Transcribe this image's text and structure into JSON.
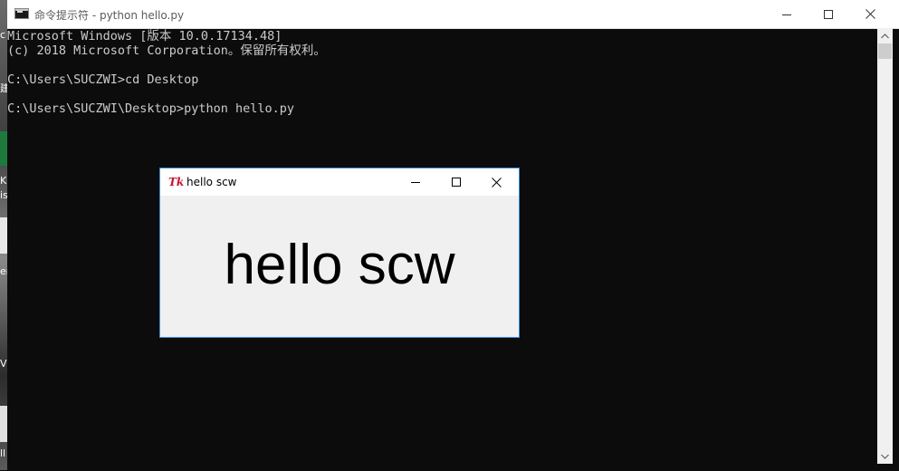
{
  "desktop": {
    "fragments": [
      "c",
      "建",
      "K",
      "is",
      "er",
      "V",
      "ll"
    ]
  },
  "cmd": {
    "title": "命令提示符 - python  hello.py",
    "icon": "cmd-icon",
    "lines": [
      "Microsoft Windows [版本 10.0.17134.48]",
      "(c) 2018 Microsoft Corporation。保留所有权利。",
      "",
      "C:\\Users\\SUCZWI>cd Desktop",
      "",
      "C:\\Users\\SUCZWI\\Desktop>python hello.py"
    ],
    "colors": {
      "background": "#0c0c0c",
      "text": "#cccccc"
    }
  },
  "tk": {
    "title": "hello scw",
    "icon_text": "Tk",
    "label": "hello scw",
    "colors": {
      "border": "#3a8ee6",
      "background": "#f0f0f0",
      "icon": "#c8102e"
    }
  }
}
